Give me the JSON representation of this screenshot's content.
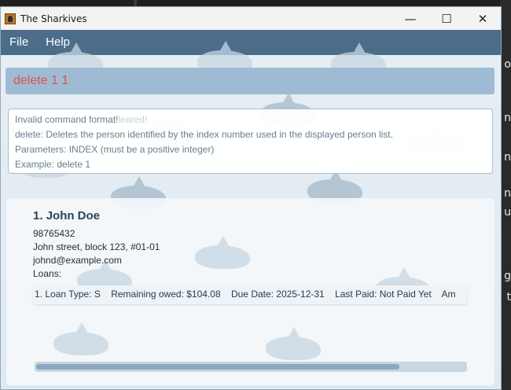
{
  "window": {
    "title": "The Sharkives",
    "minimize_glyph": "—",
    "maximize_glyph": "☐",
    "close_glyph": "✕"
  },
  "menu": {
    "file_label": "File",
    "help_label": "Help"
  },
  "command": {
    "value": "delete 1 1"
  },
  "result": {
    "line1": "Invalid command format!",
    "line1_ghost": "leared!",
    "line2": "delete: Deletes the person identified by the index number used in the displayed person list.",
    "line3": "Parameters: INDEX (must be a positive integer)",
    "line4": "Example: delete 1"
  },
  "person_list": {
    "persons": [
      {
        "index": "1.",
        "name": "John Doe",
        "phone": "98765432",
        "address": "John street, block 123, #01-01",
        "email": "johnd@example.com",
        "loans_label": "Loans:",
        "loan": {
          "prefix": "1. Loan Type: S",
          "remaining": "Remaining owed: $104.08",
          "due": "Due Date: 2025-12-31",
          "last_paid": "Last Paid: Not Paid Yet",
          "amount": "Am"
        }
      }
    ]
  },
  "scrollbar": {
    "position": 0.0
  },
  "desktop": {
    "side_glyphs": [
      "o",
      "n",
      "n",
      "n",
      "u",
      "g",
      "t"
    ]
  },
  "colors": {
    "menubar": "#4b6d8a",
    "command_box": "#9fbbd4",
    "command_text": "#d9534f",
    "result_text": "#6b7d8c"
  },
  "icons": {
    "app": "shark-app-icon",
    "minimize": "minimize-icon",
    "maximize": "maximize-icon",
    "close": "close-icon"
  }
}
